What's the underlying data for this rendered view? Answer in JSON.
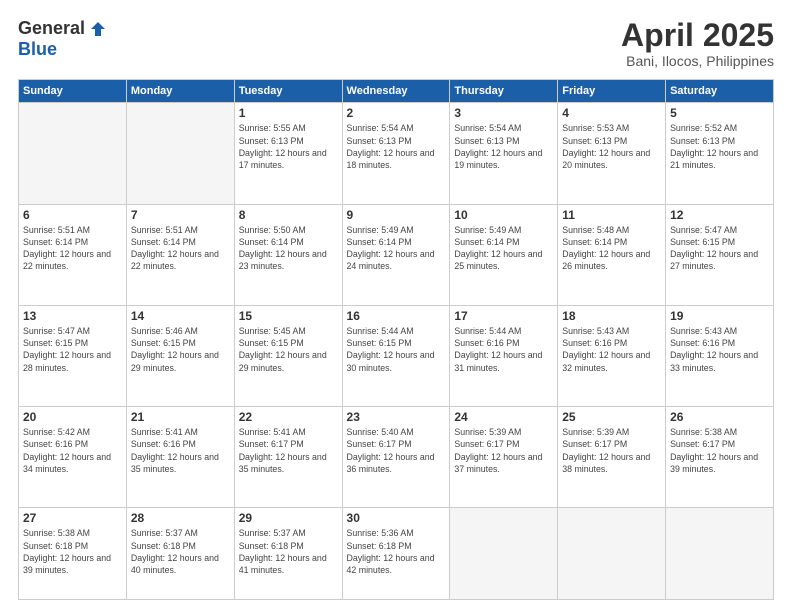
{
  "header": {
    "logo_general": "General",
    "logo_blue": "Blue",
    "title": "April 2025",
    "subtitle": "Bani, Ilocos, Philippines"
  },
  "weekdays": [
    "Sunday",
    "Monday",
    "Tuesday",
    "Wednesday",
    "Thursday",
    "Friday",
    "Saturday"
  ],
  "weeks": [
    [
      {
        "day": "",
        "empty": true
      },
      {
        "day": "",
        "empty": true
      },
      {
        "day": "1",
        "sunrise": "5:55 AM",
        "sunset": "6:13 PM",
        "daylight": "12 hours and 17 minutes."
      },
      {
        "day": "2",
        "sunrise": "5:54 AM",
        "sunset": "6:13 PM",
        "daylight": "12 hours and 18 minutes."
      },
      {
        "day": "3",
        "sunrise": "5:54 AM",
        "sunset": "6:13 PM",
        "daylight": "12 hours and 19 minutes."
      },
      {
        "day": "4",
        "sunrise": "5:53 AM",
        "sunset": "6:13 PM",
        "daylight": "12 hours and 20 minutes."
      },
      {
        "day": "5",
        "sunrise": "5:52 AM",
        "sunset": "6:13 PM",
        "daylight": "12 hours and 21 minutes."
      }
    ],
    [
      {
        "day": "6",
        "sunrise": "5:51 AM",
        "sunset": "6:14 PM",
        "daylight": "12 hours and 22 minutes."
      },
      {
        "day": "7",
        "sunrise": "5:51 AM",
        "sunset": "6:14 PM",
        "daylight": "12 hours and 22 minutes."
      },
      {
        "day": "8",
        "sunrise": "5:50 AM",
        "sunset": "6:14 PM",
        "daylight": "12 hours and 23 minutes."
      },
      {
        "day": "9",
        "sunrise": "5:49 AM",
        "sunset": "6:14 PM",
        "daylight": "12 hours and 24 minutes."
      },
      {
        "day": "10",
        "sunrise": "5:49 AM",
        "sunset": "6:14 PM",
        "daylight": "12 hours and 25 minutes."
      },
      {
        "day": "11",
        "sunrise": "5:48 AM",
        "sunset": "6:14 PM",
        "daylight": "12 hours and 26 minutes."
      },
      {
        "day": "12",
        "sunrise": "5:47 AM",
        "sunset": "6:15 PM",
        "daylight": "12 hours and 27 minutes."
      }
    ],
    [
      {
        "day": "13",
        "sunrise": "5:47 AM",
        "sunset": "6:15 PM",
        "daylight": "12 hours and 28 minutes."
      },
      {
        "day": "14",
        "sunrise": "5:46 AM",
        "sunset": "6:15 PM",
        "daylight": "12 hours and 29 minutes."
      },
      {
        "day": "15",
        "sunrise": "5:45 AM",
        "sunset": "6:15 PM",
        "daylight": "12 hours and 29 minutes."
      },
      {
        "day": "16",
        "sunrise": "5:44 AM",
        "sunset": "6:15 PM",
        "daylight": "12 hours and 30 minutes."
      },
      {
        "day": "17",
        "sunrise": "5:44 AM",
        "sunset": "6:16 PM",
        "daylight": "12 hours and 31 minutes."
      },
      {
        "day": "18",
        "sunrise": "5:43 AM",
        "sunset": "6:16 PM",
        "daylight": "12 hours and 32 minutes."
      },
      {
        "day": "19",
        "sunrise": "5:43 AM",
        "sunset": "6:16 PM",
        "daylight": "12 hours and 33 minutes."
      }
    ],
    [
      {
        "day": "20",
        "sunrise": "5:42 AM",
        "sunset": "6:16 PM",
        "daylight": "12 hours and 34 minutes."
      },
      {
        "day": "21",
        "sunrise": "5:41 AM",
        "sunset": "6:16 PM",
        "daylight": "12 hours and 35 minutes."
      },
      {
        "day": "22",
        "sunrise": "5:41 AM",
        "sunset": "6:17 PM",
        "daylight": "12 hours and 35 minutes."
      },
      {
        "day": "23",
        "sunrise": "5:40 AM",
        "sunset": "6:17 PM",
        "daylight": "12 hours and 36 minutes."
      },
      {
        "day": "24",
        "sunrise": "5:39 AM",
        "sunset": "6:17 PM",
        "daylight": "12 hours and 37 minutes."
      },
      {
        "day": "25",
        "sunrise": "5:39 AM",
        "sunset": "6:17 PM",
        "daylight": "12 hours and 38 minutes."
      },
      {
        "day": "26",
        "sunrise": "5:38 AM",
        "sunset": "6:17 PM",
        "daylight": "12 hours and 39 minutes."
      }
    ],
    [
      {
        "day": "27",
        "sunrise": "5:38 AM",
        "sunset": "6:18 PM",
        "daylight": "12 hours and 39 minutes."
      },
      {
        "day": "28",
        "sunrise": "5:37 AM",
        "sunset": "6:18 PM",
        "daylight": "12 hours and 40 minutes."
      },
      {
        "day": "29",
        "sunrise": "5:37 AM",
        "sunset": "6:18 PM",
        "daylight": "12 hours and 41 minutes."
      },
      {
        "day": "30",
        "sunrise": "5:36 AM",
        "sunset": "6:18 PM",
        "daylight": "12 hours and 42 minutes."
      },
      {
        "day": "",
        "empty": true
      },
      {
        "day": "",
        "empty": true
      },
      {
        "day": "",
        "empty": true
      }
    ]
  ],
  "labels": {
    "sunrise_prefix": "Sunrise: ",
    "sunset_prefix": "Sunset: ",
    "daylight_prefix": "Daylight: "
  }
}
